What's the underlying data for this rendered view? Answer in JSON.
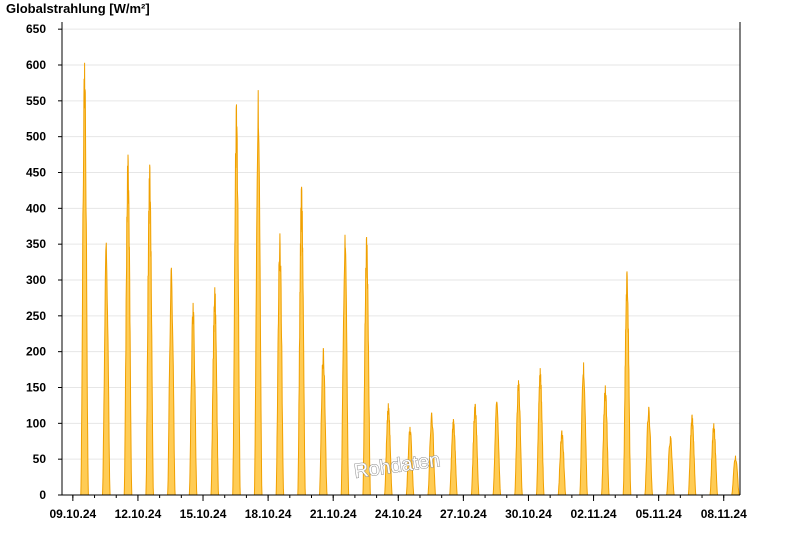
{
  "chart_data": {
    "type": "area",
    "ylabel": "Globalstrahlung [W/m²]",
    "ylim": [
      0,
      660
    ],
    "yticks": [
      0,
      50,
      100,
      150,
      200,
      250,
      300,
      350,
      400,
      450,
      500,
      550,
      600,
      650
    ],
    "xlim": [
      "2024-10-08T12:00",
      "2024-11-08T18:00"
    ],
    "xticks": [
      "09.10.24",
      "12.10.24",
      "15.10.24",
      "18.10.24",
      "21.10.24",
      "24.10.24",
      "27.10.24",
      "30.10.24",
      "02.11.24",
      "05.11.24",
      "08.11.24"
    ],
    "grid": true,
    "watermark": "Rohdaten",
    "colors": {
      "fill": "#ffcc55",
      "stroke": "#f0a000",
      "grid": "#e6e6e6",
      "axis": "#000000"
    },
    "series": [
      {
        "values_format": "daily peak",
        "values": [
          {
            "date": "2024-10-09",
            "peak": 603
          },
          {
            "date": "2024-10-10",
            "peak": 352
          },
          {
            "date": "2024-10-11",
            "peak": 475
          },
          {
            "date": "2024-10-12",
            "peak": 461
          },
          {
            "date": "2024-10-13",
            "peak": 317
          },
          {
            "date": "2024-10-14",
            "peak": 268
          },
          {
            "date": "2024-10-15",
            "peak": 290
          },
          {
            "date": "2024-10-16",
            "peak": 545
          },
          {
            "date": "2024-10-17",
            "peak": 565
          },
          {
            "date": "2024-10-18",
            "peak": 365
          },
          {
            "date": "2024-10-19",
            "peak": 430
          },
          {
            "date": "2024-10-20",
            "peak": 205
          },
          {
            "date": "2024-10-21",
            "peak": 363
          },
          {
            "date": "2024-10-22",
            "peak": 360
          },
          {
            "date": "2024-10-23",
            "peak": 128
          },
          {
            "date": "2024-10-24",
            "peak": 95
          },
          {
            "date": "2024-10-25",
            "peak": 115
          },
          {
            "date": "2024-10-26",
            "peak": 106
          },
          {
            "date": "2024-10-27",
            "peak": 127
          },
          {
            "date": "2024-10-28",
            "peak": 130
          },
          {
            "date": "2024-10-29",
            "peak": 160
          },
          {
            "date": "2024-10-30",
            "peak": 177
          },
          {
            "date": "2024-10-31",
            "peak": 90
          },
          {
            "date": "2024-11-01",
            "peak": 185
          },
          {
            "date": "2024-11-02",
            "peak": 153
          },
          {
            "date": "2024-11-03",
            "peak": 312
          },
          {
            "date": "2024-11-04",
            "peak": 123
          },
          {
            "date": "2024-11-05",
            "peak": 82
          },
          {
            "date": "2024-11-06",
            "peak": 112
          },
          {
            "date": "2024-11-07",
            "peak": 100
          },
          {
            "date": "2024-11-08",
            "peak": 55
          }
        ]
      }
    ]
  }
}
